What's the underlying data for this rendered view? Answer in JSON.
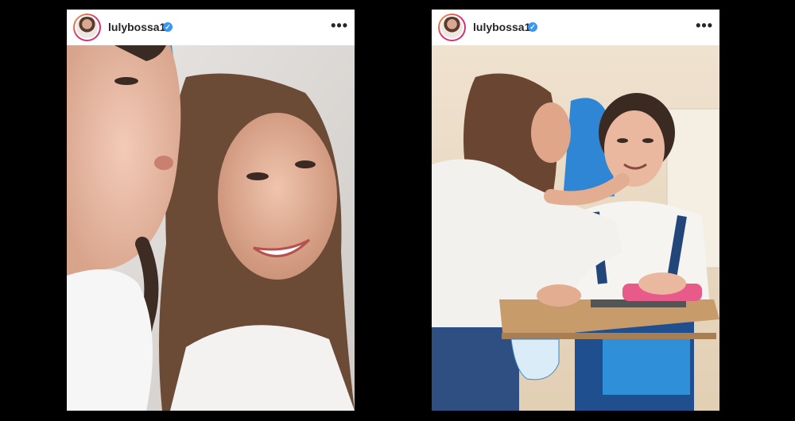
{
  "posts": [
    {
      "username": "lulybossa1",
      "verified_mark": "✓",
      "more_label": "•••",
      "icons": {
        "avatar": "profile-avatar",
        "verified": "verified-badge-icon",
        "more": "more-options-icon"
      },
      "photo_description_hidden": ""
    },
    {
      "username": "lulybossa1",
      "verified_mark": "✓",
      "more_label": "•••",
      "icons": {
        "avatar": "profile-avatar",
        "verified": "verified-badge-icon",
        "more": "more-options-icon"
      }
    }
  ],
  "colors": {
    "background": "#000000",
    "verified": "#3897f0",
    "text": "#262626"
  }
}
